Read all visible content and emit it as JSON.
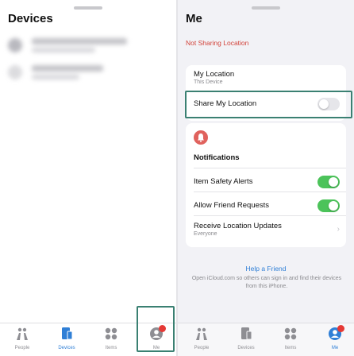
{
  "left": {
    "title": "Devices",
    "tabs": [
      {
        "label": "People",
        "icon": "people-icon",
        "active": false
      },
      {
        "label": "Devices",
        "icon": "devices-icon",
        "active": true
      },
      {
        "label": "Items",
        "icon": "items-icon",
        "active": false
      },
      {
        "label": "Me",
        "icon": "me-icon",
        "active": false
      }
    ]
  },
  "right": {
    "title": "Me",
    "status": "Not Sharing Location",
    "my_location": {
      "title": "My Location",
      "subtitle": "This Device"
    },
    "share_location": {
      "label": "Share My Location",
      "enabled": false
    },
    "notifications": {
      "heading": "Notifications",
      "item_safety": {
        "label": "Item Safety Alerts",
        "enabled": true
      },
      "friend_requests": {
        "label": "Allow Friend Requests",
        "enabled": true
      },
      "location_updates": {
        "label": "Receive Location Updates",
        "subtitle": "Everyone"
      }
    },
    "help": {
      "link": "Help a Friend",
      "text": "Open iCloud.com so others can sign in and find their devices from this iPhone."
    },
    "tabs": [
      {
        "label": "People",
        "icon": "people-icon",
        "active": false
      },
      {
        "label": "Devices",
        "icon": "devices-icon",
        "active": false
      },
      {
        "label": "Items",
        "icon": "items-icon",
        "active": false
      },
      {
        "label": "Me",
        "icon": "me-icon",
        "active": true
      }
    ]
  },
  "colors": {
    "accent": "#2f7fd6",
    "toggle_on": "#4cc35a",
    "alert_red": "#d2433a",
    "highlight": "#3a8072"
  }
}
